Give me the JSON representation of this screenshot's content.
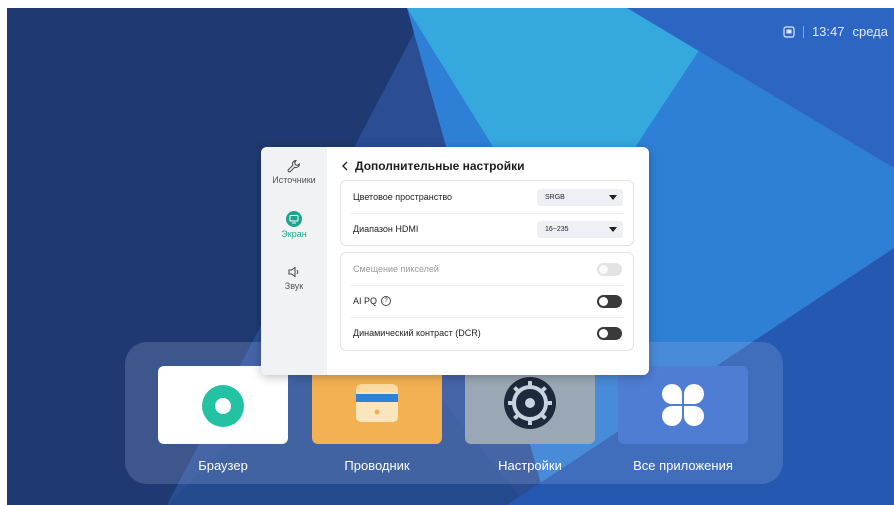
{
  "status_bar": {
    "icon": "cast-icon",
    "time": "13:47",
    "day": "среда"
  },
  "panel": {
    "sidebar": [
      {
        "label": "Источники",
        "icon": "wrench-icon",
        "active": false
      },
      {
        "label": "Экран",
        "icon": "monitor-icon",
        "active": true
      },
      {
        "label": "Звук",
        "icon": "speaker-icon",
        "active": false
      }
    ],
    "title": "Дополнительные настройки",
    "back_icon": "chevron-left-icon",
    "color_space": {
      "label": "Цветовое пространство",
      "value": "SRGB"
    },
    "hdmi_range": {
      "label": "Диапазон HDMI",
      "value": "16~235"
    },
    "pixel_shift": {
      "label": "Смещение пикселей",
      "enabled": false,
      "disabled": true
    },
    "ai_pq": {
      "label": "AI PQ",
      "enabled": false,
      "help_icon": "question-circle-icon"
    },
    "dcr": {
      "label": "Динамический контраст (DCR)",
      "enabled": false
    }
  },
  "apps": [
    {
      "label": "Браузер",
      "color": "#ffffff"
    },
    {
      "label": "Проводник",
      "color": "#f3b153"
    },
    {
      "label": "Настройки",
      "color": "#9aa8b5"
    },
    {
      "label": "Все приложения",
      "color": "#4f7dd4"
    }
  ],
  "colors": {
    "accent": "#1fa38c"
  }
}
